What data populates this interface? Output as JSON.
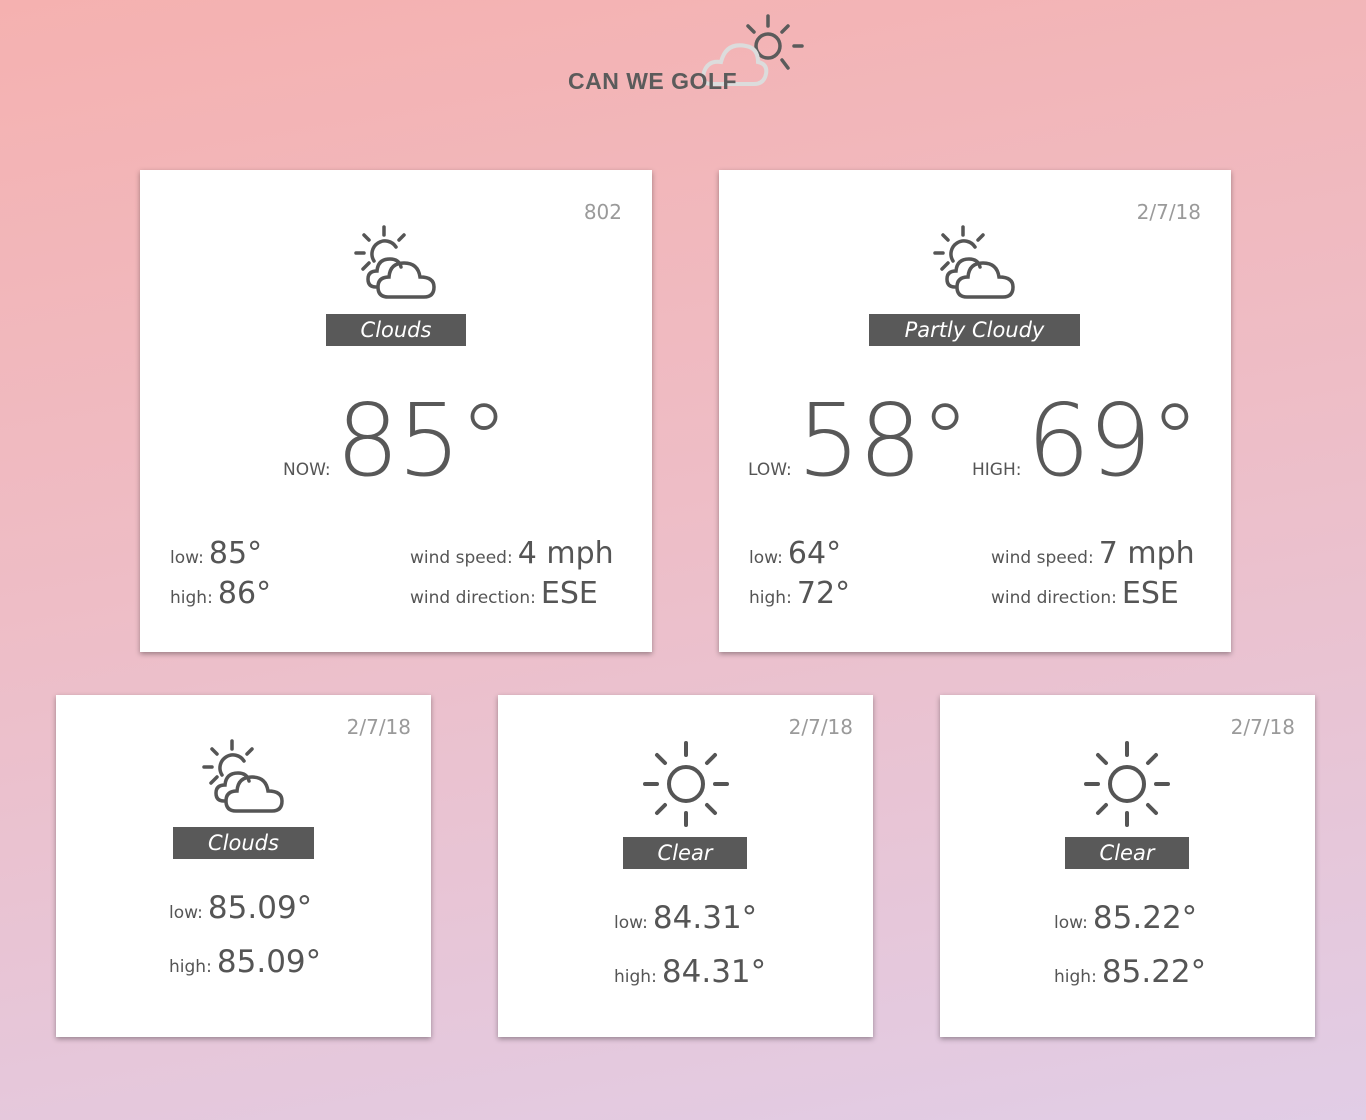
{
  "app": {
    "logo_text": "CAN WE GOLF"
  },
  "current": {
    "code": "802",
    "condition": "Clouds",
    "now_label": "NOW:",
    "now_temp": "85°",
    "low_label": "low:",
    "low": "85°",
    "high_label": "high:",
    "high": "86°",
    "wind_speed_label": "wind speed:",
    "wind_speed": "4 mph",
    "wind_direction_label": "wind direction:",
    "wind_direction": "ESE"
  },
  "today": {
    "date": "2/7/18",
    "condition": "Partly Cloudy",
    "low_big_label": "LOW:",
    "low_big": "58°",
    "high_big_label": "HIGH:",
    "high_big": "69°",
    "low_label": "low:",
    "low": "64°",
    "high_label": "high:",
    "high": "72°",
    "wind_speed_label": "wind speed:",
    "wind_speed": "7 mph",
    "wind_direction_label": "wind direction:",
    "wind_direction": "ESE"
  },
  "forecast": [
    {
      "date": "2/7/18",
      "condition": "Clouds",
      "icon": "sun-cloud-icon",
      "low_label": "low:",
      "low": "85.09°",
      "high_label": "high:",
      "high": "85.09°"
    },
    {
      "date": "2/7/18",
      "condition": "Clear",
      "icon": "sun-icon",
      "low_label": "low:",
      "low": "84.31°",
      "high_label": "high:",
      "high": "84.31°"
    },
    {
      "date": "2/7/18",
      "condition": "Clear",
      "icon": "sun-icon",
      "low_label": "low:",
      "low": "85.22°",
      "high_label": "high:",
      "high": "85.22°"
    }
  ],
  "colors": {
    "badge": "#595959",
    "text": "#555555",
    "date": "#9a9a9a"
  }
}
